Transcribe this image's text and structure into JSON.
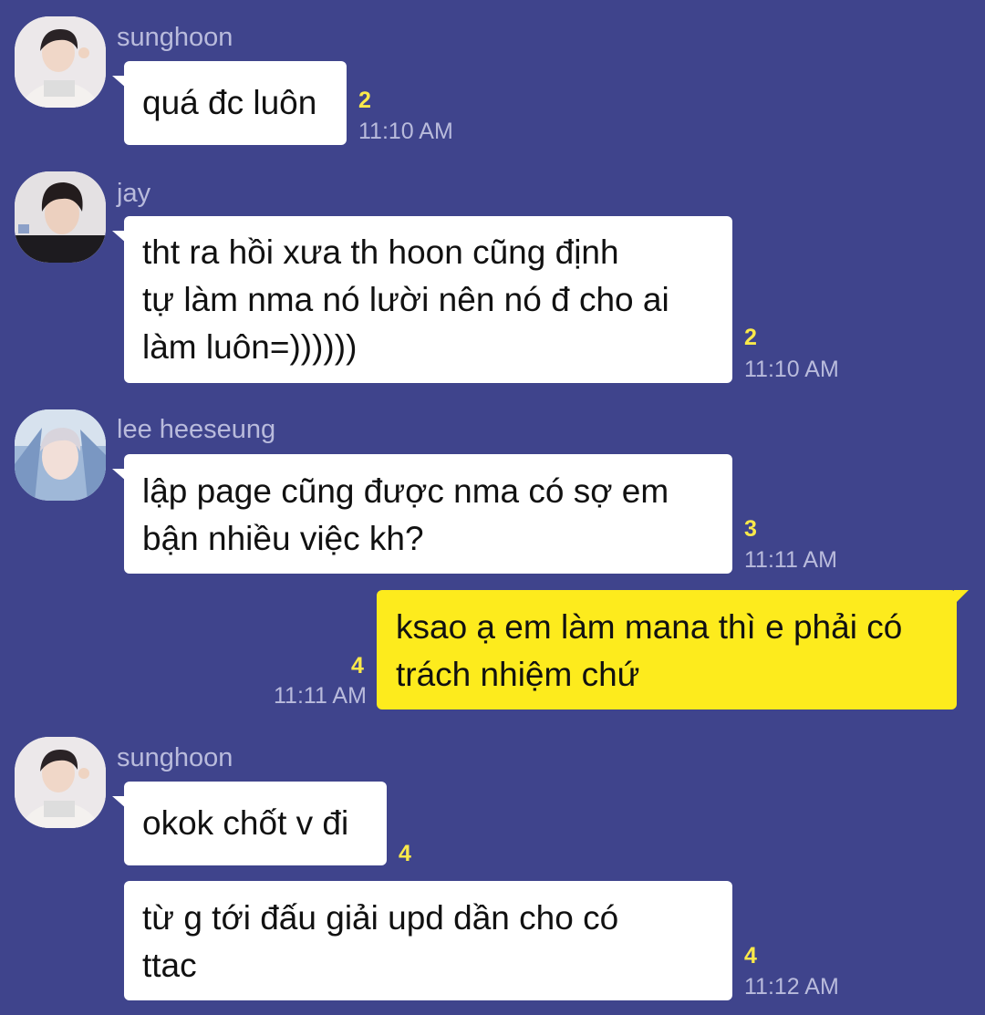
{
  "messages": [
    {
      "sender": "sunghoon",
      "text": "quá đc luôn",
      "unread": "2",
      "time": "11:10 AM"
    },
    {
      "sender": "jay",
      "text": "tht ra hồi xưa th hoon cũng định\ntự làm nma nó lười nên nó đ cho ai\nlàm luôn=))))))",
      "unread": "2",
      "time": "11:10 AM"
    },
    {
      "sender": "lee heeseung",
      "text": "lập page cũng được nma có sợ em\nbận nhiều việc kh?",
      "unread": "3",
      "time": "11:11 AM"
    },
    {
      "sender": "",
      "text": "ksao ạ em làm mana thì e phải có\ntrách nhiệm chứ",
      "unread": "4",
      "time": "11:11 AM"
    },
    {
      "sender": "sunghoon",
      "text": "okok chốt v đi",
      "unread": "4",
      "time": ""
    },
    {
      "sender": "",
      "text": "từ g tới đấu giải upd dần cho có\nttac",
      "unread": "4",
      "time": "11:12 AM"
    }
  ],
  "colors": {
    "background": "#3f448c",
    "incoming_bubble": "#ffffff",
    "outgoing_bubble": "#fdeb1d",
    "unread_count": "#fae94a",
    "meta_text": "#b9bbdc"
  }
}
